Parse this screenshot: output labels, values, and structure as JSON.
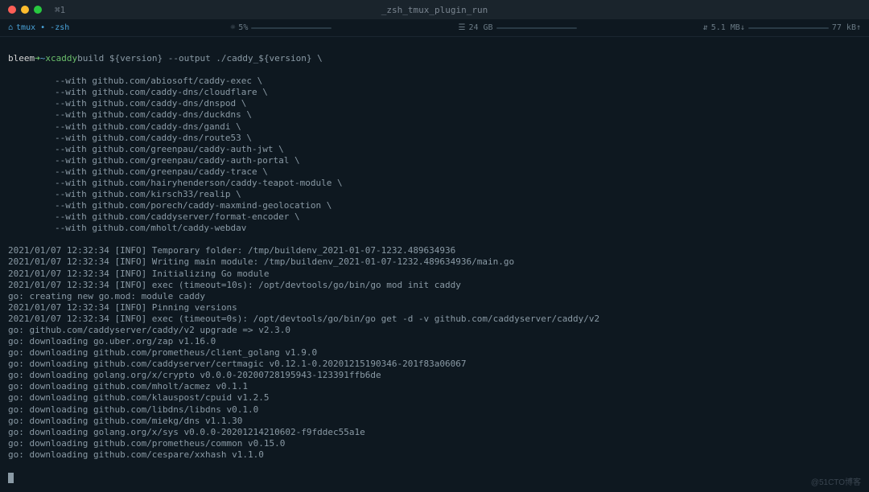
{
  "titlebar": {
    "title": "_zsh_tmux_plugin_run",
    "left_icon": "⌘1"
  },
  "tabbar": {
    "session": "tmux • -zsh",
    "cpu_icon": "☼",
    "cpu": "5%",
    "mem_icon": "☰",
    "mem": "24 GB",
    "net_icon": "⇵",
    "net_down": "5.1 MB↓",
    "net_up": "77 kB↑"
  },
  "prompt": {
    "user": "bleem",
    "arrow": "➜",
    "tilde": "~",
    "command": "xcaddy",
    "args": "build ${version} --output ./caddy_${version} \\"
  },
  "with_lines": [
    "--with github.com/abiosoft/caddy-exec \\",
    "--with github.com/caddy-dns/cloudflare \\",
    "--with github.com/caddy-dns/dnspod \\",
    "--with github.com/caddy-dns/duckdns \\",
    "--with github.com/caddy-dns/gandi \\",
    "--with github.com/caddy-dns/route53 \\",
    "--with github.com/greenpau/caddy-auth-jwt \\",
    "--with github.com/greenpau/caddy-auth-portal \\",
    "--with github.com/greenpau/caddy-trace \\",
    "--with github.com/hairyhenderson/caddy-teapot-module \\",
    "--with github.com/kirsch33/realip \\",
    "--with github.com/porech/caddy-maxmind-geolocation \\",
    "--with github.com/caddyserver/format-encoder \\",
    "--with github.com/mholt/caddy-webdav"
  ],
  "output_lines": [
    "2021/01/07 12:32:34 [INFO] Temporary folder: /tmp/buildenv_2021-01-07-1232.489634936",
    "2021/01/07 12:32:34 [INFO] Writing main module: /tmp/buildenv_2021-01-07-1232.489634936/main.go",
    "2021/01/07 12:32:34 [INFO] Initializing Go module",
    "2021/01/07 12:32:34 [INFO] exec (timeout=10s): /opt/devtools/go/bin/go mod init caddy",
    "go: creating new go.mod: module caddy",
    "2021/01/07 12:32:34 [INFO] Pinning versions",
    "2021/01/07 12:32:34 [INFO] exec (timeout=0s): /opt/devtools/go/bin/go get -d -v github.com/caddyserver/caddy/v2",
    "go: github.com/caddyserver/caddy/v2 upgrade => v2.3.0",
    "go: downloading go.uber.org/zap v1.16.0",
    "go: downloading github.com/prometheus/client_golang v1.9.0",
    "go: downloading github.com/caddyserver/certmagic v0.12.1-0.20201215190346-201f83a06067",
    "go: downloading golang.org/x/crypto v0.0.0-20200728195943-123391ffb6de",
    "go: downloading github.com/mholt/acmez v0.1.1",
    "go: downloading github.com/klauspost/cpuid v1.2.5",
    "go: downloading github.com/libdns/libdns v0.1.0",
    "go: downloading github.com/miekg/dns v1.1.30",
    "go: downloading golang.org/x/sys v0.0.0-20201214210602-f9fddec55a1e",
    "go: downloading github.com/prometheus/common v0.15.0",
    "go: downloading github.com/cespare/xxhash v1.1.0"
  ],
  "watermark": "@51CTO博客"
}
